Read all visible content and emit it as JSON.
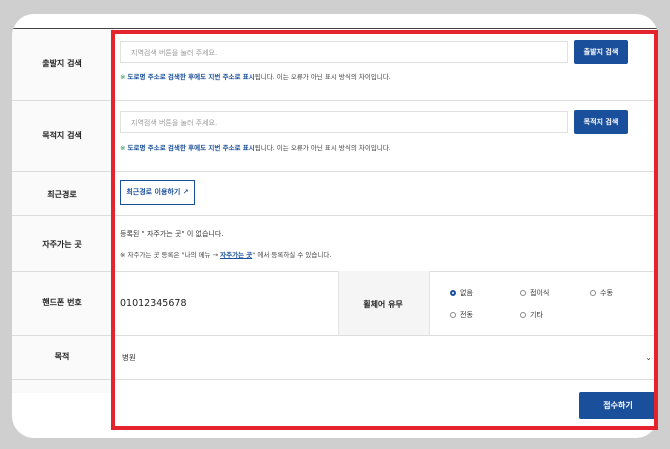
{
  "departure": {
    "label": "출발지 검색",
    "placeholder": "지역검색 버튼을 눌러 주세요.",
    "button": "출발지 검색",
    "note_star": "※",
    "note_highlight": "도로명 주소로 검색한 후에도 지번 주소로 표시",
    "note_rest": "됩니다. 이는 오류가 아닌 표시 방식의 차이입니다."
  },
  "destination": {
    "label": "목적지 검색",
    "placeholder": "지역검색 버튼을 눌러 주세요.",
    "button": "목적지 검색",
    "note_star": "※",
    "note_highlight": "도로명 주소로 검색한 후에도 지번 주소로 표시",
    "note_rest": "됩니다. 이는 오류가 아닌 표시 방식의 차이입니다."
  },
  "recent": {
    "label": "최근경로",
    "button": "최근경로 이용하기"
  },
  "favorites": {
    "label": "자주가는 곳",
    "empty_text": "등록된 \" 자주가는 곳\" 이 없습니다.",
    "note_prefix": "※ 자주가는 곳 등록은 \"나의 메뉴 → ",
    "note_link": "자주가는 곳",
    "note_suffix": "\" 에서 등록하실 수 있습니다."
  },
  "phone": {
    "label": "핸드폰 번호",
    "value": "01012345678"
  },
  "wheelchair": {
    "label": "휠체어 유무",
    "options": [
      "없음",
      "접이식",
      "수동",
      "전동",
      "기타"
    ],
    "selected": "없음"
  },
  "purpose": {
    "label": "목적",
    "value": "병원"
  },
  "submit_label": "접수하기",
  "colors": {
    "accent": "#1a4f9c",
    "highlight_box": "#e4232d"
  }
}
